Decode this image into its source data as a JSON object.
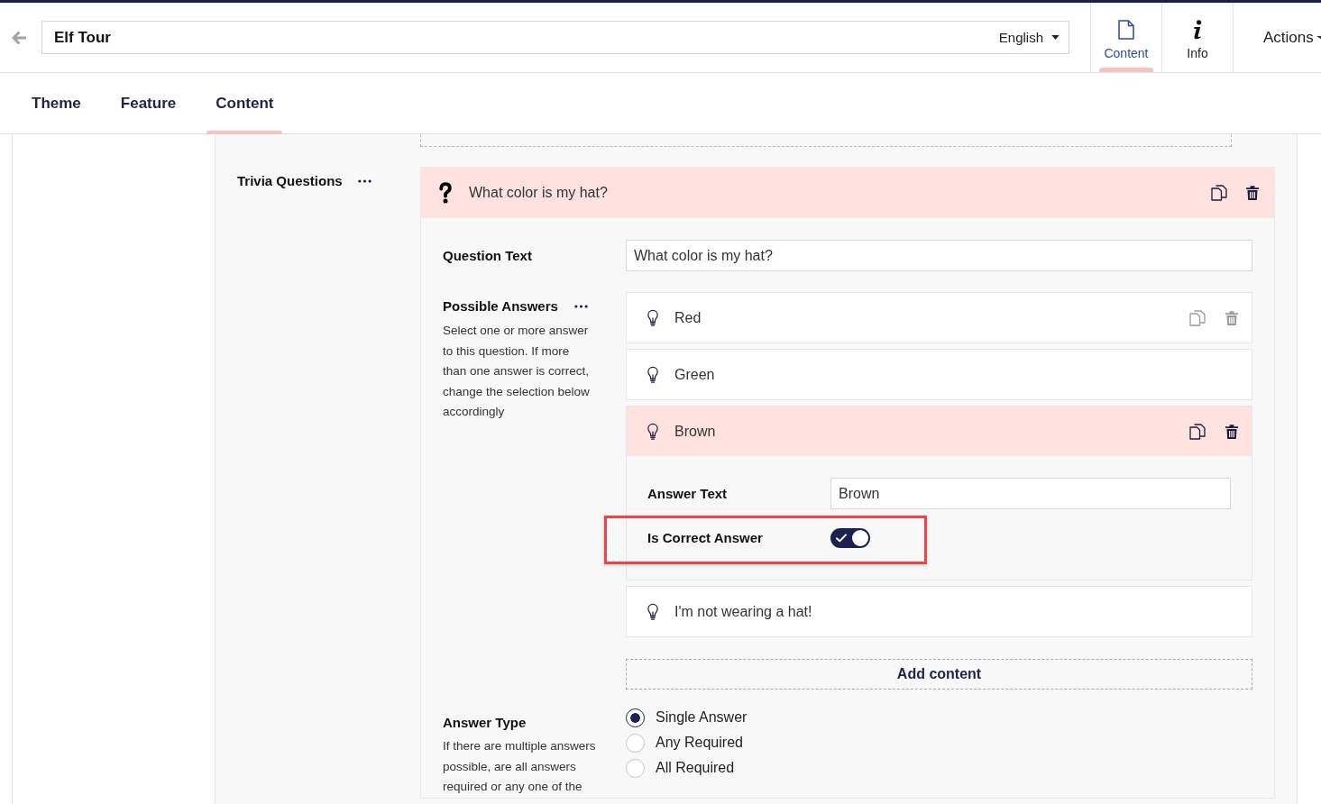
{
  "header": {
    "title": "Elf Tour",
    "language": "English"
  },
  "toolbar": [
    {
      "kind": "content",
      "label": "Content",
      "selected": true
    },
    {
      "kind": "info",
      "label": "Info",
      "selected": false
    },
    {
      "kind": "actions",
      "label": "Actions",
      "selected": false
    }
  ],
  "tabs": [
    {
      "label": "Theme",
      "selected": false
    },
    {
      "label": "Feature",
      "selected": false
    },
    {
      "label": "Content",
      "selected": true
    }
  ],
  "section": {
    "label": "Trivia Questions"
  },
  "question": {
    "title": "What color is my hat?",
    "expanded": true,
    "question_text": {
      "label": "Question Text",
      "value": "What color is my hat?"
    },
    "possible_answers": {
      "label": "Possible Answers",
      "help": "Select one or more answer to this question. If more than one answer is correct, change the selection below accordingly",
      "answers": [
        {
          "text": "Red",
          "hovered": true,
          "expanded": false
        },
        {
          "text": "Green",
          "hovered": false,
          "expanded": false
        },
        {
          "text": "Brown",
          "hovered": false,
          "expanded": true,
          "answer_text": {
            "label": "Answer Text",
            "value": "Brown"
          },
          "correct": {
            "label": "Is Correct Answer",
            "on": true,
            "highlighted": true
          }
        },
        {
          "text": "I'm not wearing a hat!",
          "hovered": false,
          "expanded": false
        }
      ],
      "add_label": "Add content"
    },
    "answer_type": {
      "label": "Answer Type",
      "help": "If there are multiple answers possible, are all answers required or any one of the",
      "options": [
        {
          "label": "Single Answer",
          "selected": true
        },
        {
          "label": "Any Required",
          "selected": false
        },
        {
          "label": "All Required",
          "selected": false
        }
      ]
    }
  }
}
